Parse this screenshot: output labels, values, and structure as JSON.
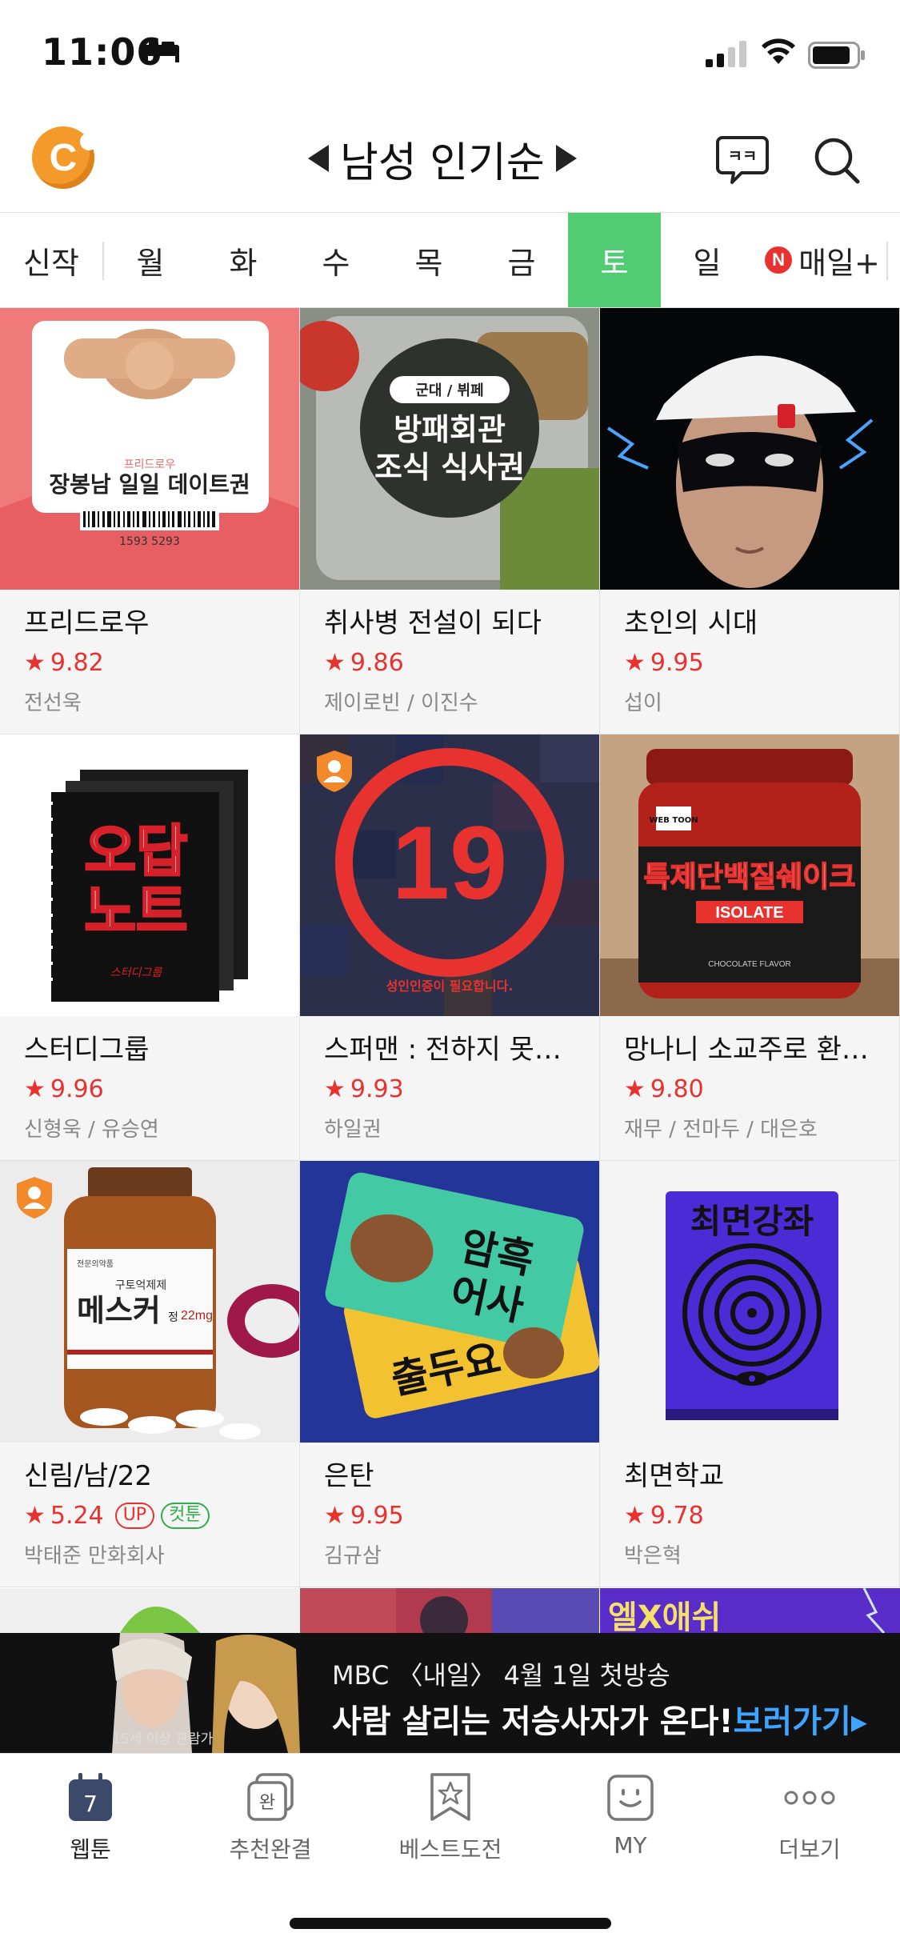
{
  "status_bar": {
    "time": "11:06"
  },
  "header": {
    "title": "남성 인기순"
  },
  "tabs": [
    {
      "label": "신작"
    },
    {
      "label": "월"
    },
    {
      "label": "화"
    },
    {
      "label": "수"
    },
    {
      "label": "목"
    },
    {
      "label": "금"
    },
    {
      "label": "토"
    },
    {
      "label": "일"
    },
    {
      "label": "매일+",
      "badge": "N"
    }
  ],
  "active_tab": "토",
  "thumb_text": {
    "c1_small": "프리드로우",
    "c1_main": "장봉남 일일 데이트권",
    "c1_num": "1593    5293",
    "c2_tag": "군대 / 뷔페",
    "c2_line1": "방패회관",
    "c2_line2": "조식 식사권",
    "c5_num": "19",
    "c5_notice": "성인인증이 필요합니다.",
    "c4_line1": "오답",
    "c4_line2": "노트",
    "c4_small": "스터디그룹",
    "c6_brand": "WEB TOON",
    "c6_main": "특제단백질쉐이크",
    "c6_sub": "ISOLATE",
    "c6_flavor": "CHOCOLATE FLAVOR",
    "c7_line1": "구토억제제",
    "c7_main": "메스커",
    "c7_small": "정",
    "c7_dose": "22mg",
    "c8_line1": "암흑",
    "c8_line2": "어사",
    "c8_line3": "출두요",
    "c9_title": "최면강좌",
    "r4_c3": "엘X애쉬"
  },
  "webtoons": [
    {
      "title": "프리드로우",
      "rating": "9.82",
      "author": "전선욱"
    },
    {
      "title": "취사병 전설이 되다",
      "rating": "9.86",
      "author": "제이로빈 / 이진수"
    },
    {
      "title": "초인의 시대",
      "rating": "9.95",
      "author": "섭이"
    },
    {
      "title": "스터디그룹",
      "rating": "9.96",
      "author": "신형욱 / 유승연"
    },
    {
      "title": "스퍼맨 : 전하지 못…",
      "rating": "9.93",
      "author": "하일권"
    },
    {
      "title": "망나니 소교주로 환…",
      "rating": "9.80",
      "author": "재무 / 전마두 / 대은호"
    },
    {
      "title": "신림/남/22",
      "rating": "5.24",
      "author": "박태준 만화회사",
      "badges": [
        "UP",
        "컷툰"
      ]
    },
    {
      "title": "은탄",
      "rating": "9.95",
      "author": "김규삼"
    },
    {
      "title": "최면학교",
      "rating": "9.78",
      "author": "박은혁"
    }
  ],
  "ad": {
    "line1": "MBC 〈내일〉 4월 1일 첫방송",
    "line2": "사람 살리는 저승사자가 온다!",
    "cta": "보러가기▸",
    "age": "15세 이상 관람가"
  },
  "bottom_nav": [
    {
      "label": "웹툰",
      "icon_text": "7"
    },
    {
      "label": "추천완결",
      "icon_text": "완"
    },
    {
      "label": "베스트도전"
    },
    {
      "label": "MY"
    },
    {
      "label": "더보기"
    }
  ],
  "colors": {
    "accent_green": "#52cc72",
    "rating_red": "#e8322f",
    "cut_green": "#2fae4a",
    "logo_orange": "#f39a2b"
  }
}
